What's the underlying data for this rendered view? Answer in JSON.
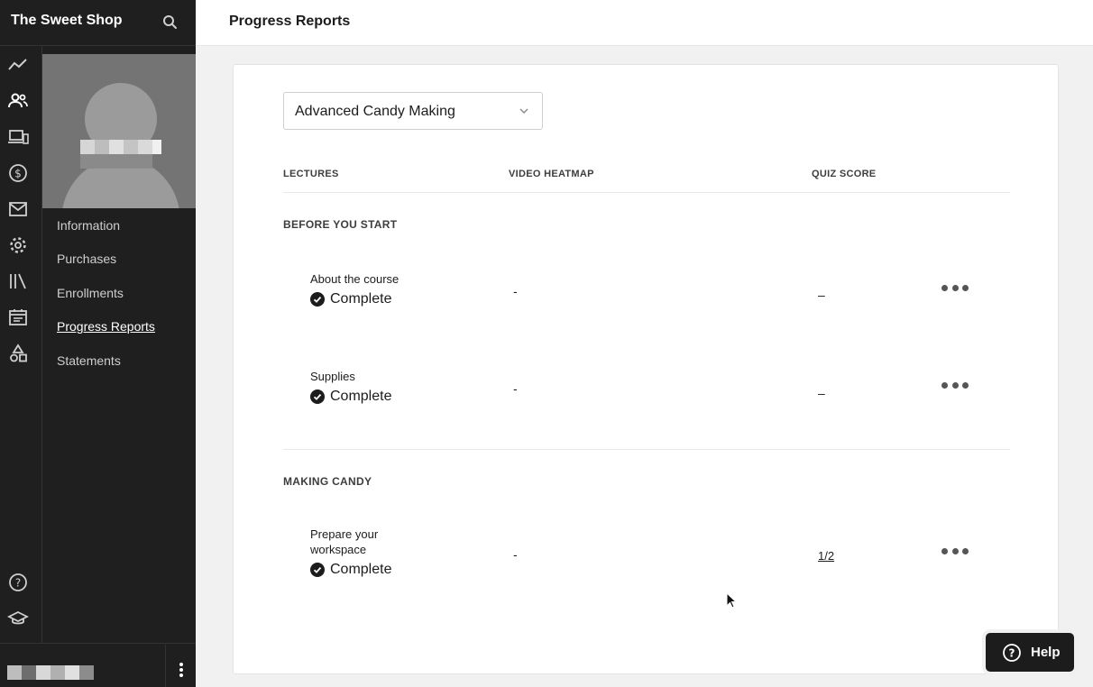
{
  "app": {
    "title": "The Sweet Shop"
  },
  "header": {
    "title": "Progress Reports"
  },
  "rail": {
    "icons": [
      "analytics-icon",
      "users-icon",
      "devices-icon",
      "dollar-icon",
      "mail-icon",
      "gear-icon",
      "library-icon",
      "calendar-icon",
      "shapes-icon"
    ],
    "bottom_icons": [
      "help-circle-icon",
      "graduation-cap-icon"
    ]
  },
  "subnav": {
    "items": [
      {
        "label": "Information"
      },
      {
        "label": "Purchases"
      },
      {
        "label": "Enrollments"
      },
      {
        "label": "Progress Reports",
        "active": true
      },
      {
        "label": "Statements"
      }
    ]
  },
  "course_select": {
    "value": "Advanced Candy Making"
  },
  "table": {
    "columns": {
      "lectures": "LECTURES",
      "video_heatmap": "VIDEO HEATMAP",
      "quiz_score": "QUIZ SCORE"
    },
    "sections": [
      {
        "title": "BEFORE YOU START",
        "lectures": [
          {
            "name": "About the course",
            "status": "Complete",
            "heatmap": "-",
            "quiz": "–"
          },
          {
            "name": "Supplies",
            "status": "Complete",
            "heatmap": "-",
            "quiz": "–"
          }
        ]
      },
      {
        "title": "MAKING CANDY",
        "lectures": [
          {
            "name": "Prepare your workspace",
            "status": "Complete",
            "heatmap": "-",
            "quiz": "1/2"
          }
        ]
      }
    ]
  },
  "help_button": {
    "label": "Help"
  },
  "colors": {
    "sidebar_bg": "#1f1f1f",
    "page_bg": "#f1f1f1",
    "card_bg": "#ffffff",
    "text": "#1c1c1c"
  }
}
